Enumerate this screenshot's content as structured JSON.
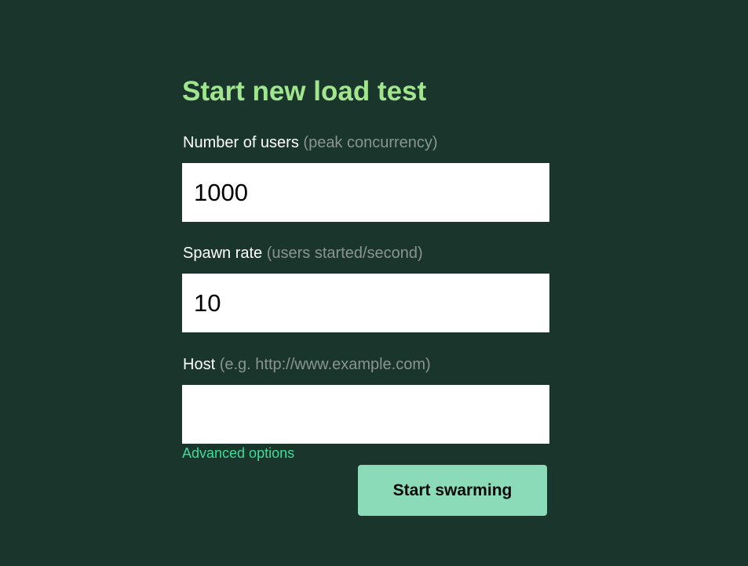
{
  "form": {
    "title": "Start new load test",
    "users": {
      "label": "Number of users",
      "hint": "(peak concurrency)",
      "value": "1000"
    },
    "spawn_rate": {
      "label": "Spawn rate",
      "hint": "(users started/second)",
      "value": "10"
    },
    "host": {
      "label": "Host",
      "hint": "(e.g. http://www.example.com)",
      "value": ""
    },
    "advanced_options_label": "Advanced options",
    "submit_label": "Start swarming"
  },
  "colors": {
    "background": "#1a352c",
    "title": "#a2e58f",
    "hint": "#8a958f",
    "link": "#3ddc97",
    "button": "#8bdbb8"
  }
}
